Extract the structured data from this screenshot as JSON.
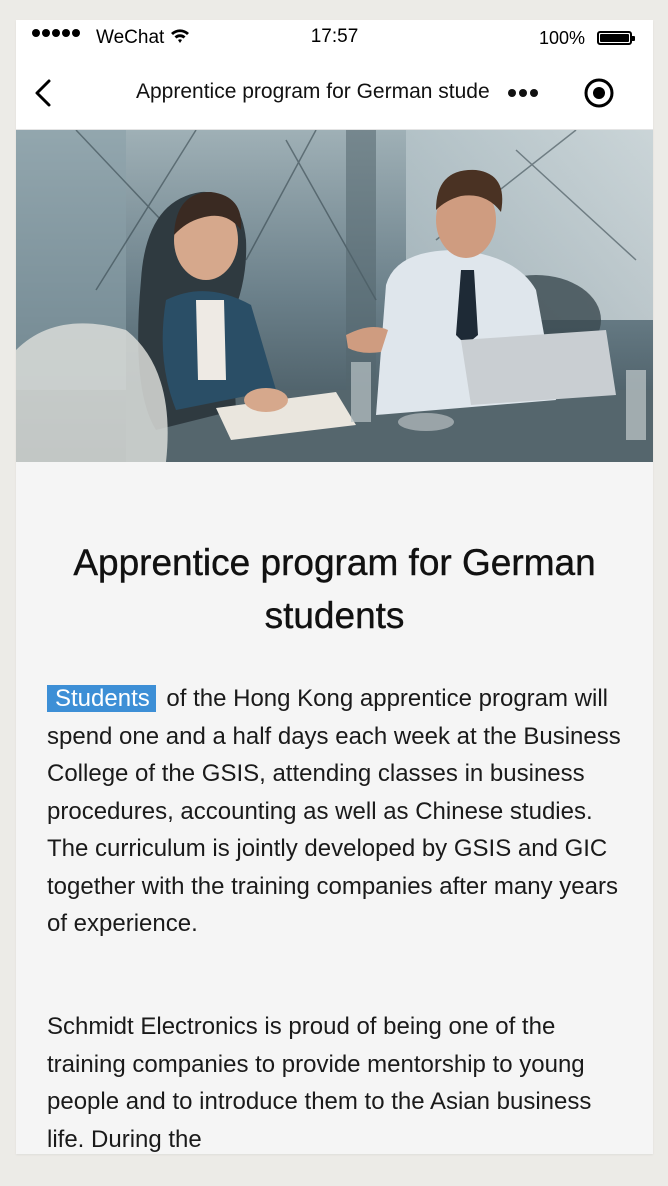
{
  "status_bar": {
    "carrier": "WeChat",
    "time": "17:57",
    "battery": "100%"
  },
  "nav": {
    "title": "Apprentice program for German stude"
  },
  "article": {
    "title": "Apprentice program for German students",
    "highlight_word": "Students",
    "paragraph1": " of the Hong Kong apprentice program will spend one and a half days each week at the Business College of the GSIS, attending classes in business procedures, accounting as well as Chinese studies. The curriculum is jointly developed by GSIS and GIC together with the training companies after many years of experience.",
    "paragraph2": "Schmidt Electronics is proud of being one of the training companies to provide mentorship to young people and to introduce them to the Asian business life. During the"
  },
  "colors": {
    "highlight": "#3d8fd6",
    "page_bg": "#f5f5f5"
  }
}
